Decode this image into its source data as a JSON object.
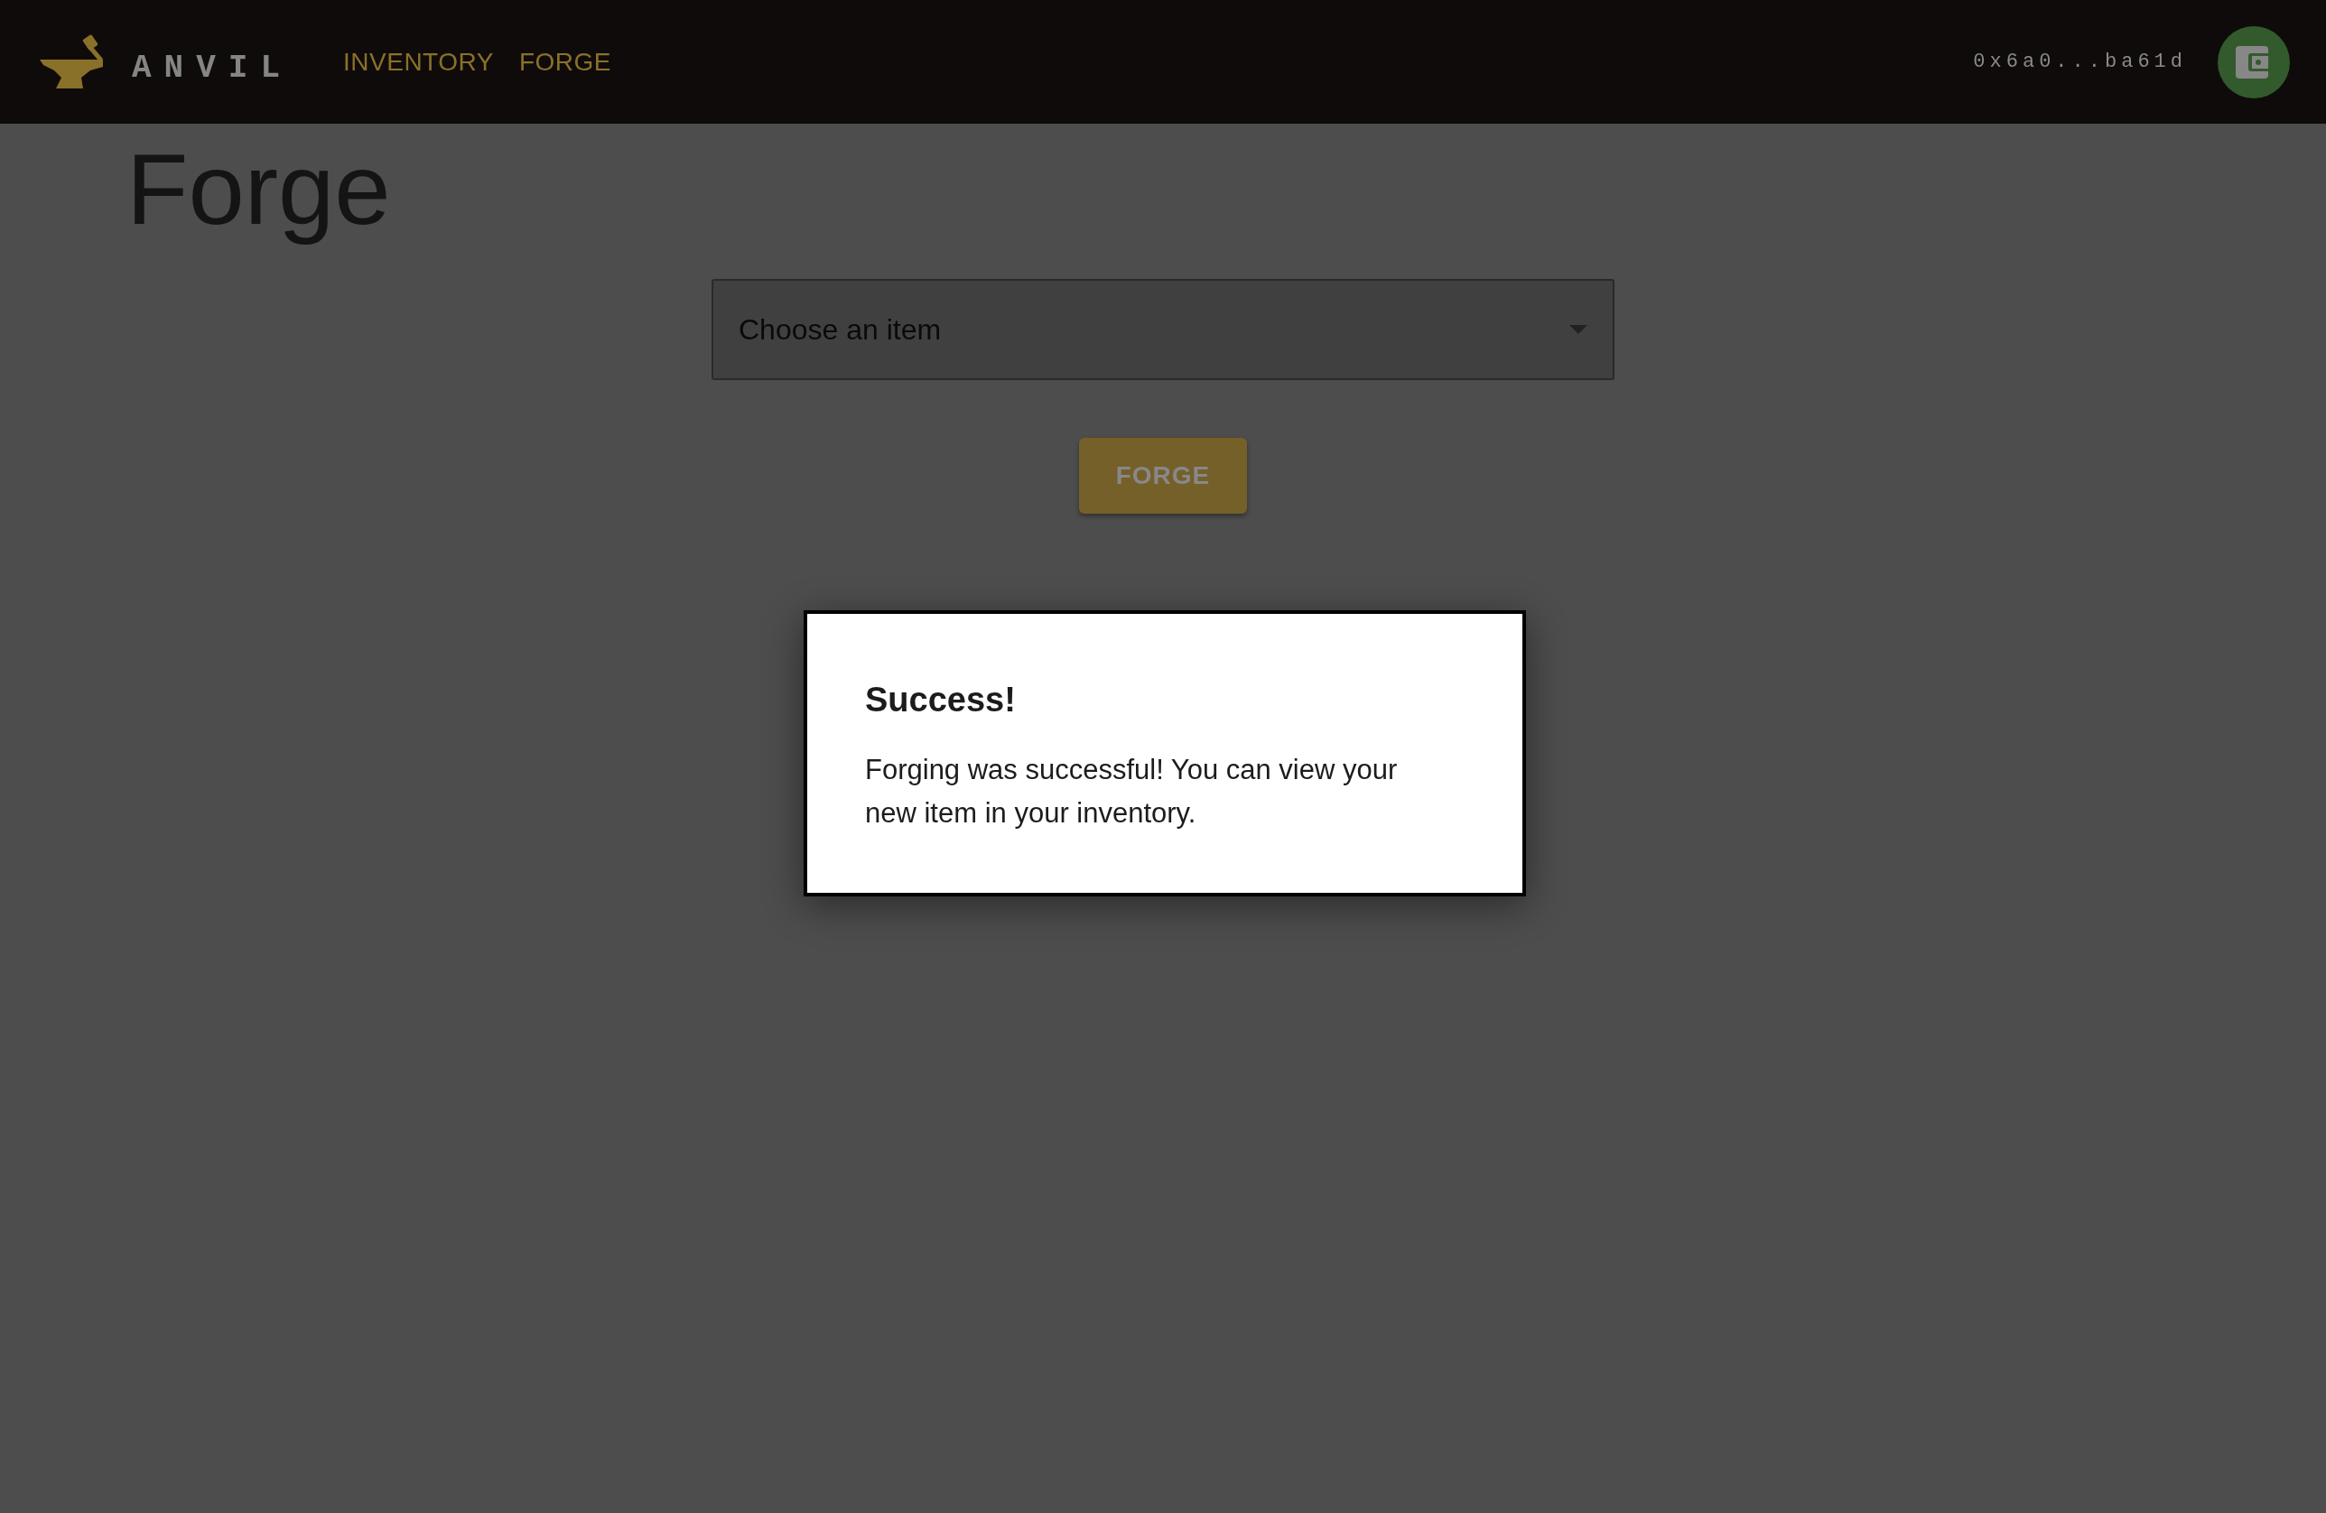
{
  "header": {
    "brand": "ANVIL",
    "nav": [
      "INVENTORY",
      "FORGE"
    ],
    "address": "0x6a0...ba61d"
  },
  "page": {
    "title": "Forge",
    "select": {
      "placeholder": "Choose an item"
    },
    "button": "FORGE"
  },
  "dialog": {
    "title": "Success!",
    "body": "Forging was successful! You can view your new item in your inventory."
  }
}
